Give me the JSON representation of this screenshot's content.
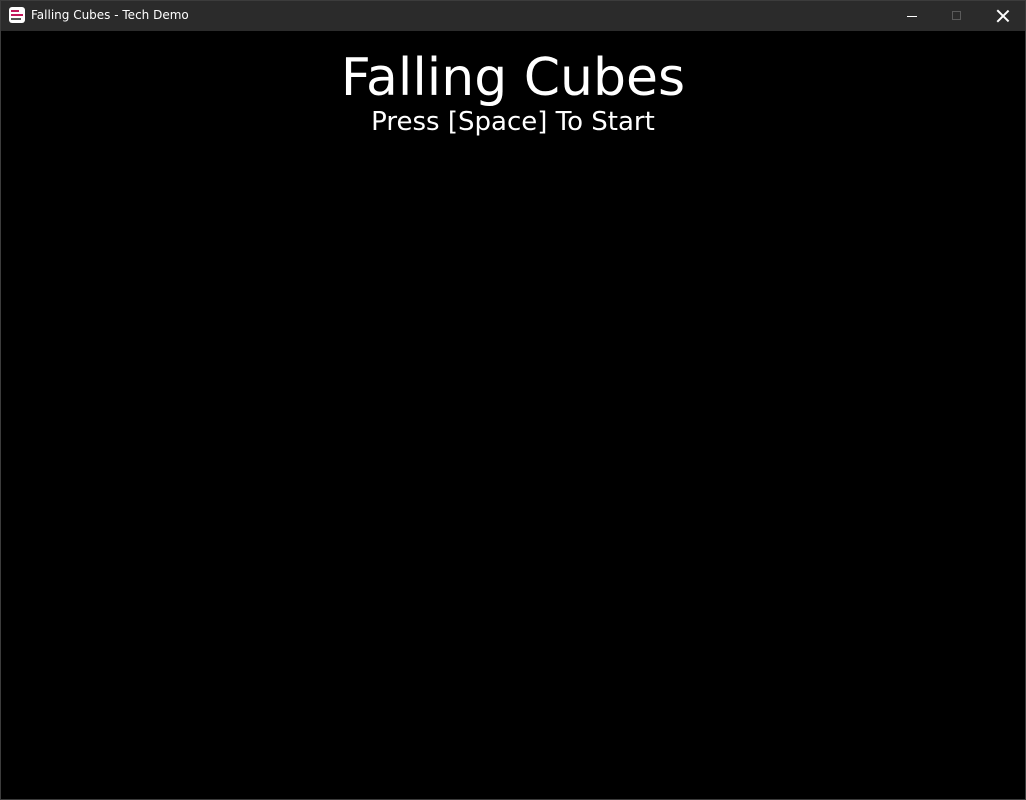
{
  "window": {
    "title": "Falling Cubes - Tech Demo",
    "icon": "app-icon",
    "controls": {
      "minimize_icon": "minimize-icon",
      "maximize_icon": "maximize-icon",
      "close_icon": "close-icon"
    },
    "colors": {
      "titlebar": "#2b2b2b",
      "background": "#000000",
      "text": "#ffffff"
    }
  },
  "game": {
    "title": "Falling Cubes",
    "prompt": "Press [Space] To Start"
  }
}
